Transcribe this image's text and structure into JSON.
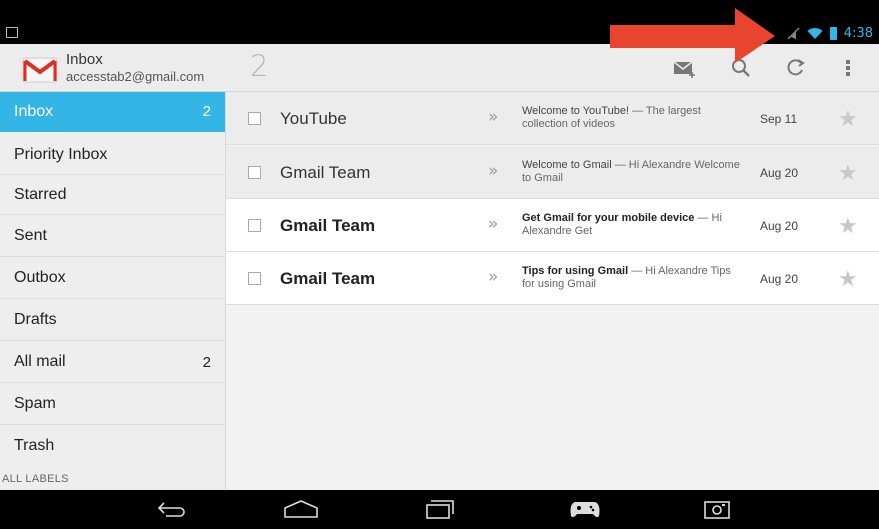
{
  "status_bar": {
    "time": "4:38"
  },
  "header": {
    "title": "Inbox",
    "account": "accesstab2@gmail.com",
    "unread_count": "2"
  },
  "sidebar": {
    "items": [
      {
        "label": "Inbox",
        "count": "2"
      },
      {
        "label": "Priority Inbox",
        "count": ""
      },
      {
        "label": "Starred",
        "count": ""
      },
      {
        "label": "Sent",
        "count": ""
      },
      {
        "label": "Outbox",
        "count": ""
      },
      {
        "label": "Drafts",
        "count": ""
      },
      {
        "label": "All mail",
        "count": "2"
      },
      {
        "label": "Spam",
        "count": ""
      },
      {
        "label": "Trash",
        "count": ""
      }
    ],
    "section_label": "ALL LABELS"
  },
  "messages": [
    {
      "sender": "YouTube",
      "subject": "Welcome to YouTube!",
      "snippet": " — The largest collection of videos",
      "date": "Sep 11",
      "read": true
    },
    {
      "sender": "Gmail Team",
      "subject": "Welcome to Gmail",
      "snippet": " — Hi Alexandre Welcome to Gmail",
      "date": "Aug 20",
      "read": true
    },
    {
      "sender": "Gmail Team",
      "subject": "Get Gmail for your mobile device",
      "snippet": " — Hi Alexandre Get",
      "date": "Aug 20",
      "read": false
    },
    {
      "sender": "Gmail Team",
      "subject": "Tips for using Gmail",
      "snippet": " — Hi Alexandre Tips for using Gmail",
      "date": "Aug 20",
      "read": false
    }
  ],
  "colors": {
    "accent": "#33b5e5",
    "annotation_arrow": "#e8442e"
  },
  "icons": {
    "compose": "compose-icon",
    "search": "search-icon",
    "refresh": "refresh-icon",
    "overflow": "overflow-menu-icon",
    "back": "back-icon",
    "home": "home-icon",
    "recents": "recent-apps-icon",
    "games": "gamepad-icon",
    "screenshot": "screenshot-icon"
  }
}
